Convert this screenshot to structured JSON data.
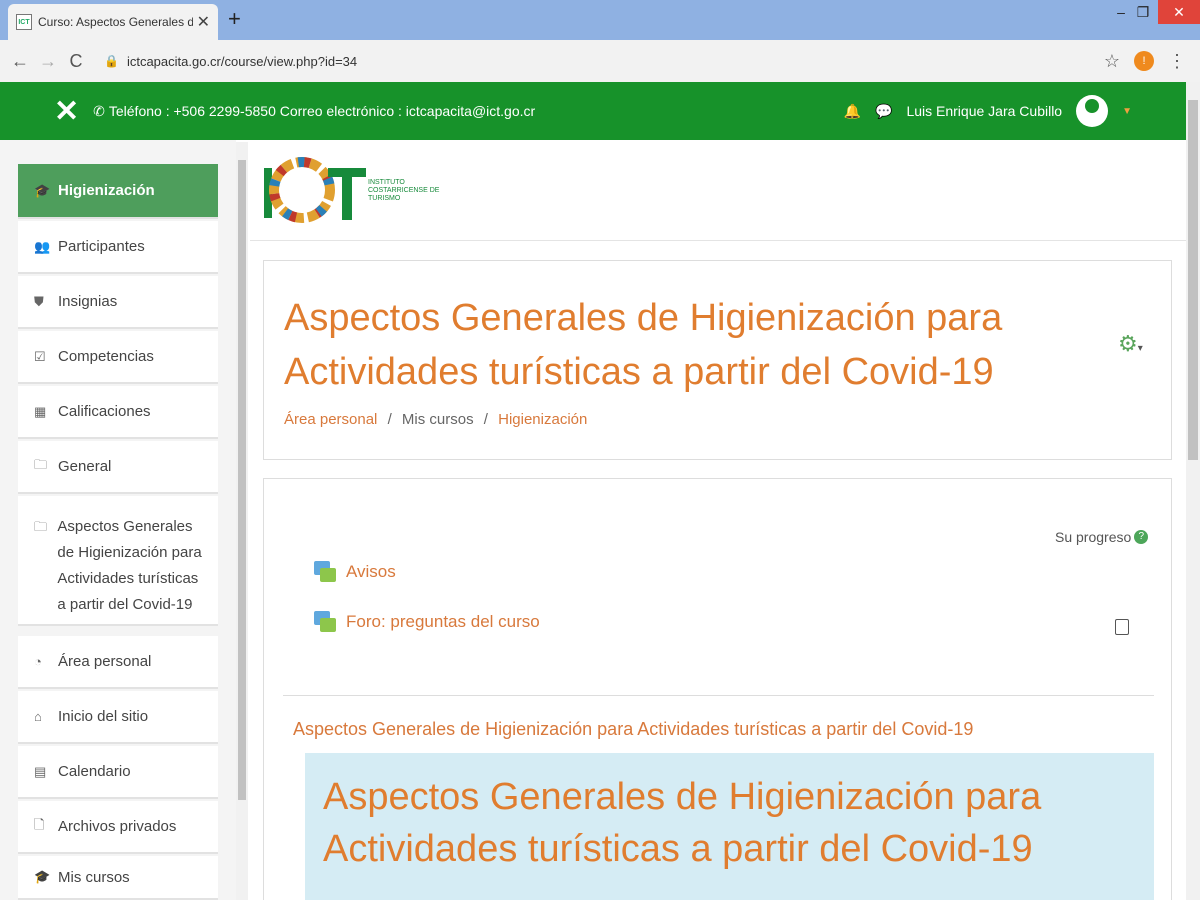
{
  "browser": {
    "tab_title": "Curso: Aspectos Generales de Hi",
    "url": "ictcapacita.go.cr/course/view.php?id=34",
    "profile_initial": "!"
  },
  "navbar": {
    "contact": "Teléfono : +506 2299-5850  Correo electrónico : ictcapacita@ict.go.cr",
    "user_name": "Luis Enrique Jara Cubillo"
  },
  "logo": {
    "line1": "INSTITUTO",
    "line2": "COSTARRICENSE DE",
    "line3": "TURISMO"
  },
  "sidebar": {
    "items": [
      {
        "label": "Higienización",
        "icon": "graduation-cap-icon"
      },
      {
        "label": "Participantes",
        "icon": "users-icon"
      },
      {
        "label": "Insignias",
        "icon": "shield-icon"
      },
      {
        "label": "Competencias",
        "icon": "checkbox-icon"
      },
      {
        "label": "Calificaciones",
        "icon": "table-icon"
      },
      {
        "label": "General",
        "icon": "folder-icon"
      },
      {
        "label": "Aspectos Generales de Higienización para Actividades turísticas a partir del Covid-19",
        "icon": "folder-icon"
      },
      {
        "label": "Área personal",
        "icon": "dashboard-icon"
      },
      {
        "label": "Inicio del sitio",
        "icon": "home-icon"
      },
      {
        "label": "Calendario",
        "icon": "calendar-icon"
      },
      {
        "label": "Archivos privados",
        "icon": "file-icon"
      },
      {
        "label": "Mis cursos",
        "icon": "graduation-cap-icon"
      }
    ]
  },
  "course": {
    "title": "Aspectos Generales de Higienización para Actividades turísticas a partir del Covid-19",
    "breadcrumb": [
      "Área personal",
      "Mis cursos",
      "Higienización"
    ]
  },
  "content": {
    "progress_label": "Su progreso",
    "activities": [
      "Avisos",
      "Foro: preguntas del curso"
    ],
    "section_title": "Aspectos Generales de Higienización para Actividades turísticas a partir del Covid-19",
    "banner_title": "Aspectos Generales de Higienización para Actividades turísticas a partir del Covid-19"
  },
  "colors": {
    "navbar": "#17922a",
    "accent_orange": "#e07d2f",
    "sidebar_active": "#4e9e5c",
    "banner": "#d5ecf4"
  }
}
